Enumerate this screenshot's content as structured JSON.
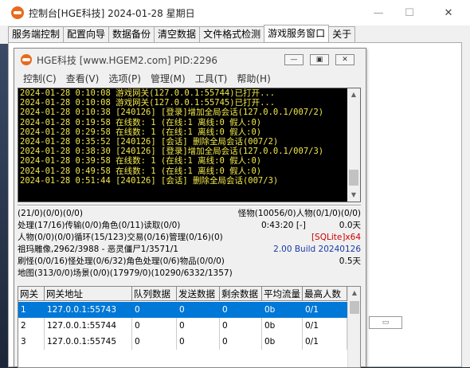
{
  "outer": {
    "title": "控制台[HGE科技] 2024-01-28 星期日",
    "minimize_glyph": "—",
    "maximize_glyph": "☐",
    "close_glyph": "✕"
  },
  "tabs": [
    {
      "label": "服务端控制"
    },
    {
      "label": "配置向导"
    },
    {
      "label": "数据备份"
    },
    {
      "label": "清空数据"
    },
    {
      "label": "文件格式检测"
    },
    {
      "label": "游戏服务窗口"
    },
    {
      "label": "关于"
    }
  ],
  "active_tab": 5,
  "inner": {
    "title": "HGE科技 [www.HGEM2.com] PID:2296",
    "minimize_glyph": "—",
    "restore_glyph": "▣",
    "close_glyph": "✕",
    "menu": [
      "控制(C)",
      "查看(V)",
      "选项(P)",
      "管理(M)",
      "工具(T)",
      "帮助(H)"
    ]
  },
  "log": [
    "2024-01-28 0:10:08 游戏网关(127.0.0.1:55744)已打开...",
    "2024-01-28 0:10:08 游戏网关(127.0.0.1:55745)已打开...",
    "2024-01-28 0:10:38 [240126] [登录]增加全局会话(127.0.0.1/007/2)",
    "2024-01-28 0:19:58 在线数: 1 (在线:1 离线:0 假人:0)",
    "2024-01-28 0:29:58 在线数: 1 (在线:1 离线:0 假人:0)",
    "2024-01-28 0:35:52 [240126] [会话] 删除全局会话(007/2)",
    "2024-01-28 0:38:30 [240126] [登录]增加全局会话(127.0.0.1/007/3)",
    "2024-01-28 0:39:58 在线数: 1 (在线:1 离线:0 假人:0)",
    "2024-01-28 0:49:58 在线数: 1 (在线:1 离线:0 假人:0)",
    "2024-01-28 0:51:44 [240126] [会话] 删除全局会话(007/3)"
  ],
  "status": {
    "row1_left": "(21/0)(0/0)(0/0)",
    "row1_right": "怪物(10056/0)人物(0/1/0)(0/0)",
    "row2_left": "处理(17/16)传输(0/0)角色(0/11)读取(0/0)",
    "row2_mid": "0:43:20 [-]",
    "row2_right": "0.0天",
    "row3_left": "人物(0/0)(0/0)循环(15/123)交易(0/16)管理(0/16)(0)",
    "row3_right": "[SQLite]x64",
    "row4_left": "祖玛雕像,2962/3988 - 恶灵僵尸1/3571/1",
    "row4_right": "2.00 Build 20240126",
    "row5_left": "刷怪(0/0/16)怪处理(0/6/32)角色处理(0/6)物品(0/0/0)",
    "row5_right": "0.5天",
    "row6_left": "地图(313/0/0)场景(0/0)(17979/0)(10290/6332/1357)"
  },
  "colors": {
    "log_text": "#f2e84c",
    "sqlite_tag": "#cc0000",
    "build_text": "#1a3aa8",
    "selection": "#0078d7"
  },
  "grid": {
    "headers": [
      "网关",
      "网关地址",
      "队列数据",
      "发送数据",
      "剩余数据",
      "平均流量",
      "最高人数"
    ],
    "rows": [
      [
        "1",
        "127.0.0.1:55743",
        "0",
        "0",
        "0",
        "0b",
        "0/1"
      ],
      [
        "2",
        "127.0.0.1:55744",
        "0",
        "0",
        "0",
        "0b",
        "0/1"
      ],
      [
        "3",
        "127.0.0.1:55745",
        "0",
        "0",
        "0",
        "0b",
        "0/1"
      ]
    ],
    "selected_row": 0
  },
  "side_button": "▭"
}
